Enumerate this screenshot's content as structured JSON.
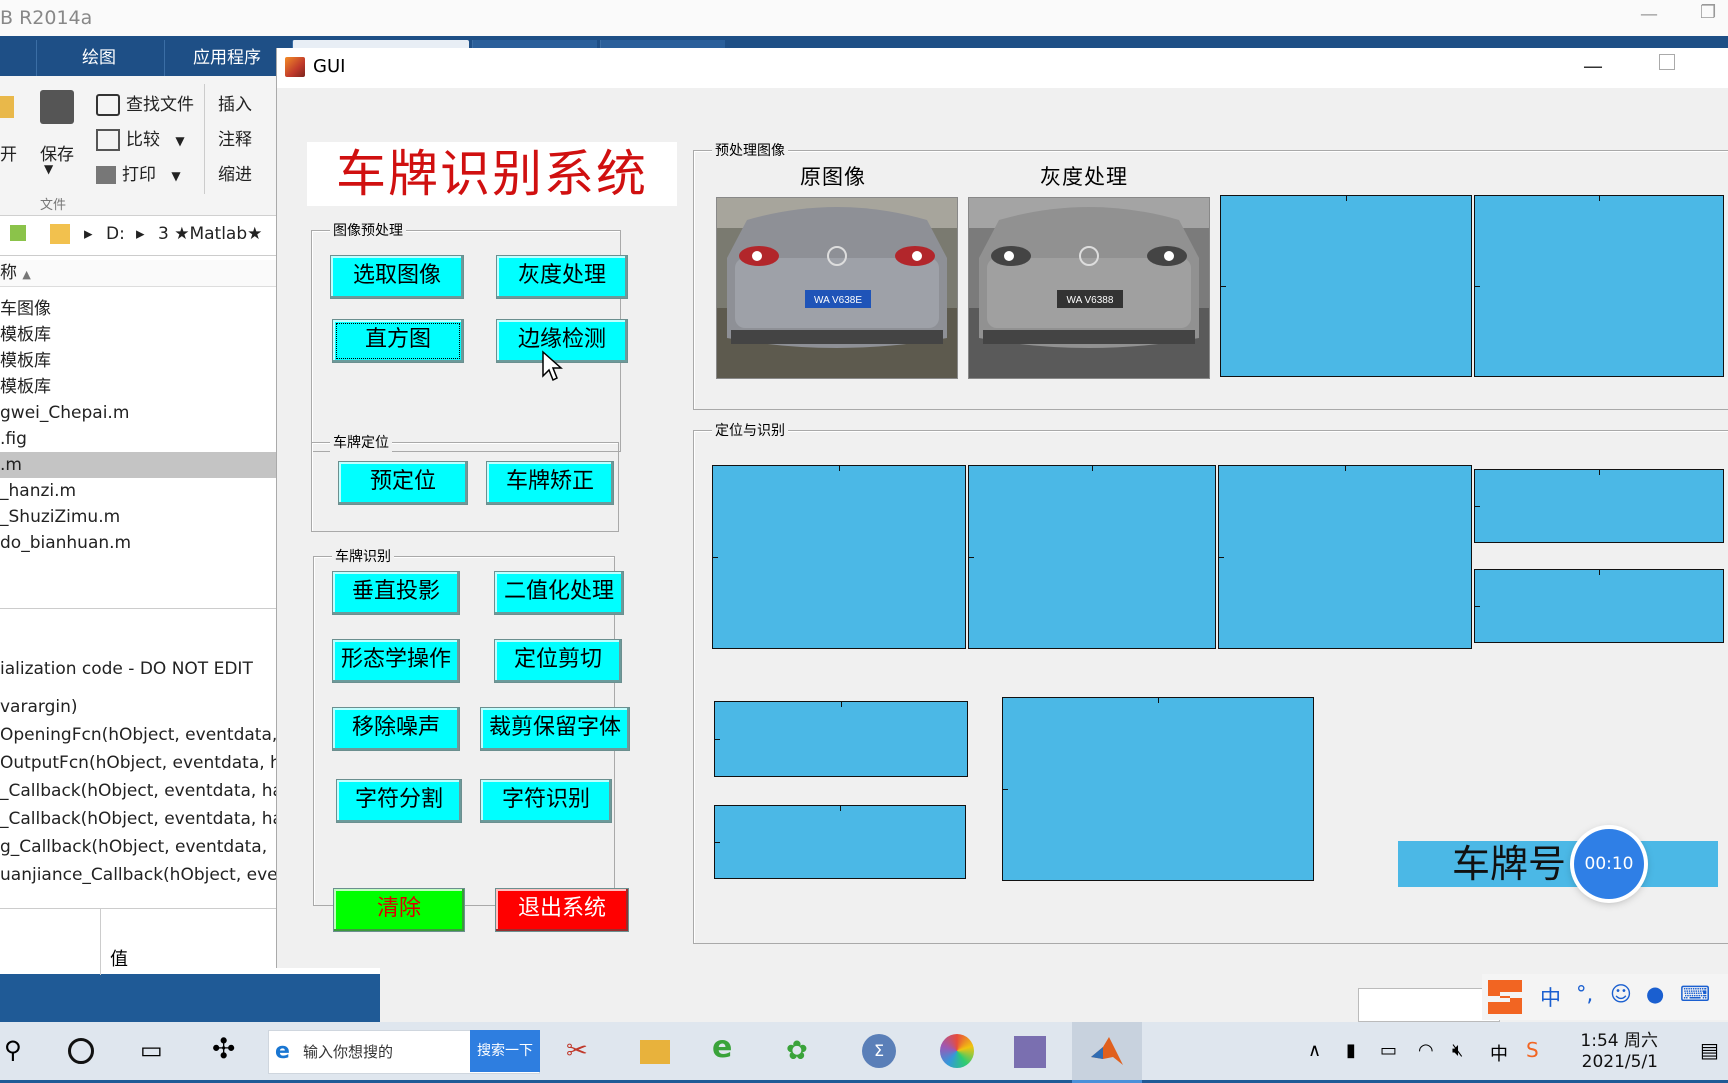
{
  "matlab": {
    "title": "B R2014a",
    "tabs": [
      "绘图",
      "应用程序"
    ],
    "ribbon": {
      "open": "开",
      "save": "保存",
      "find_files": "查找文件",
      "compare": "比较",
      "print": "打印",
      "insert": "插入",
      "comment": "注释",
      "indent": "缩进",
      "section_label": "文件"
    },
    "address": {
      "drive": "D:",
      "folder": "3 ★Matlab★"
    },
    "files_header": "称",
    "files": [
      "车图像",
      "模板库",
      "模板库",
      "模板库",
      "gwei_Chepai.m",
      ".fig",
      ".m",
      "_hanzi.m",
      "_ShuziZimu.m",
      "do_bianhuan.m"
    ],
    "selected_file_index": 6,
    "details_header": "",
    "code": [
      "ialization code - DO NOT EDIT",
      "varargin)",
      "OpeningFcn(hObject, eventdata, ",
      "OutputFcn(hObject, eventdata, ha",
      "_Callback(hObject, eventdata, ha",
      "_Callback(hObject, eventdata, ha",
      "g_Callback(hObject, eventdata, ",
      "uanjiance_Callback(hObject, even"
    ],
    "workspace_value_header": "值"
  },
  "gui": {
    "window_title": "GUI",
    "system_title": "车牌识别系统",
    "preprocess_panel": "图像预处理",
    "locate_panel": "车牌定位",
    "recognize_panel": "车牌识别",
    "preview_panel": "预处理图像",
    "locate_recognize_panel": "定位与识别",
    "buttons": {
      "select_image": "选取图像",
      "grayscale": "灰度处理",
      "histogram": "直方图",
      "edge_detect": "边缘检测",
      "pre_locate": "预定位",
      "plate_correct": "车牌矫正",
      "vertical_projection": "垂直投影",
      "binarize": "二值化处理",
      "morphology": "形态学操作",
      "locate_crop": "定位剪切",
      "remove_noise": "移除噪声",
      "crop_keep_chars": "裁剪保留字体",
      "char_split": "字符分割",
      "char_recognize": "字符识别",
      "clear": "清除",
      "exit": "退出系统"
    },
    "labels": {
      "original": "原图像",
      "gray": "灰度处理"
    },
    "plate_text_original": "WA V638E",
    "plate_text_gray": "WA V6388",
    "plate_number_label": "车牌号",
    "timer": "00:10"
  },
  "taskbar": {
    "search_placeholder": "输入你想搜的",
    "search_button": "搜索一下",
    "time": "1:54 周六",
    "date": "2021/5/1",
    "ime_lang": "中"
  },
  "colors": {
    "axes": "#4bb8e6",
    "button": "#00ffff",
    "clear": "#00ff00",
    "exit": "#ff0000",
    "title": "#d01010"
  }
}
